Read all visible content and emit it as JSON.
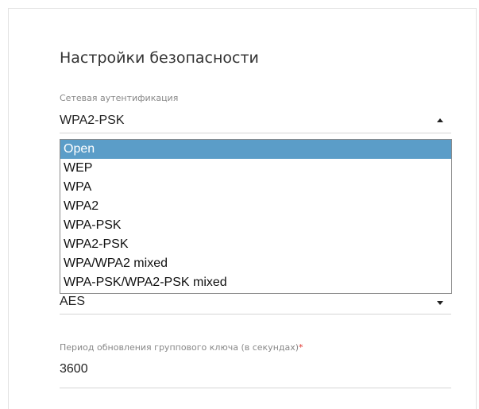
{
  "security": {
    "title": "Настройки безопасности",
    "auth": {
      "label": "Сетевая аутентификация",
      "value": "WPA2-PSK",
      "options": [
        "Open",
        "WEP",
        "WPA",
        "WPA2",
        "WPA-PSK",
        "WPA2-PSK",
        "WPA/WPA2 mixed",
        "WPA-PSK/WPA2-PSK mixed"
      ],
      "highlighted_option": "Open"
    },
    "cipher": {
      "value": "AES"
    },
    "rekey": {
      "label": "Период обновления группового ключа (в секундах)",
      "required_mark": "*",
      "value": "3600"
    }
  },
  "colors": {
    "highlight": "#5b9dc8",
    "required": "#e0312a"
  }
}
